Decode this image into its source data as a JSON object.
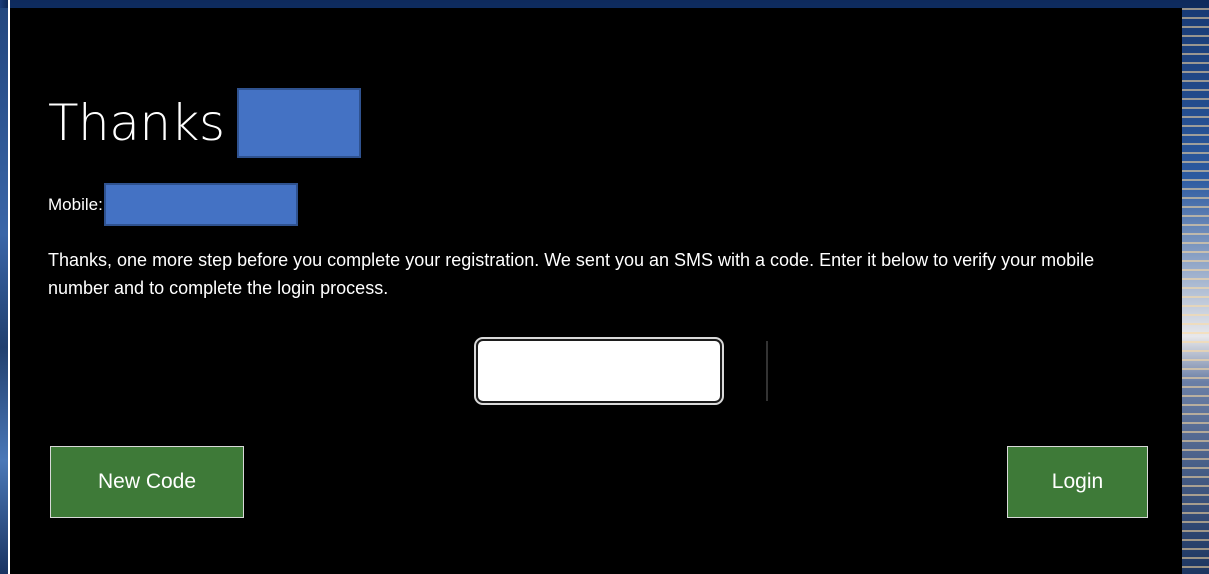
{
  "page": {
    "title": "Thanks",
    "mobile_label": "Mobile:",
    "instructions": "Thanks, one more step before you complete your registration. We sent you an SMS with a code. Enter it below to verify your mobile number and to complete the login process."
  },
  "code_input": {
    "value_first": "",
    "value_second": ""
  },
  "buttons": {
    "new_code_label": "New Code",
    "login_label": "Login"
  },
  "colors": {
    "panel_background": "#000000",
    "button_green": "#3e7a38",
    "redaction_blue": "#4472c4",
    "text": "#ffffff"
  }
}
